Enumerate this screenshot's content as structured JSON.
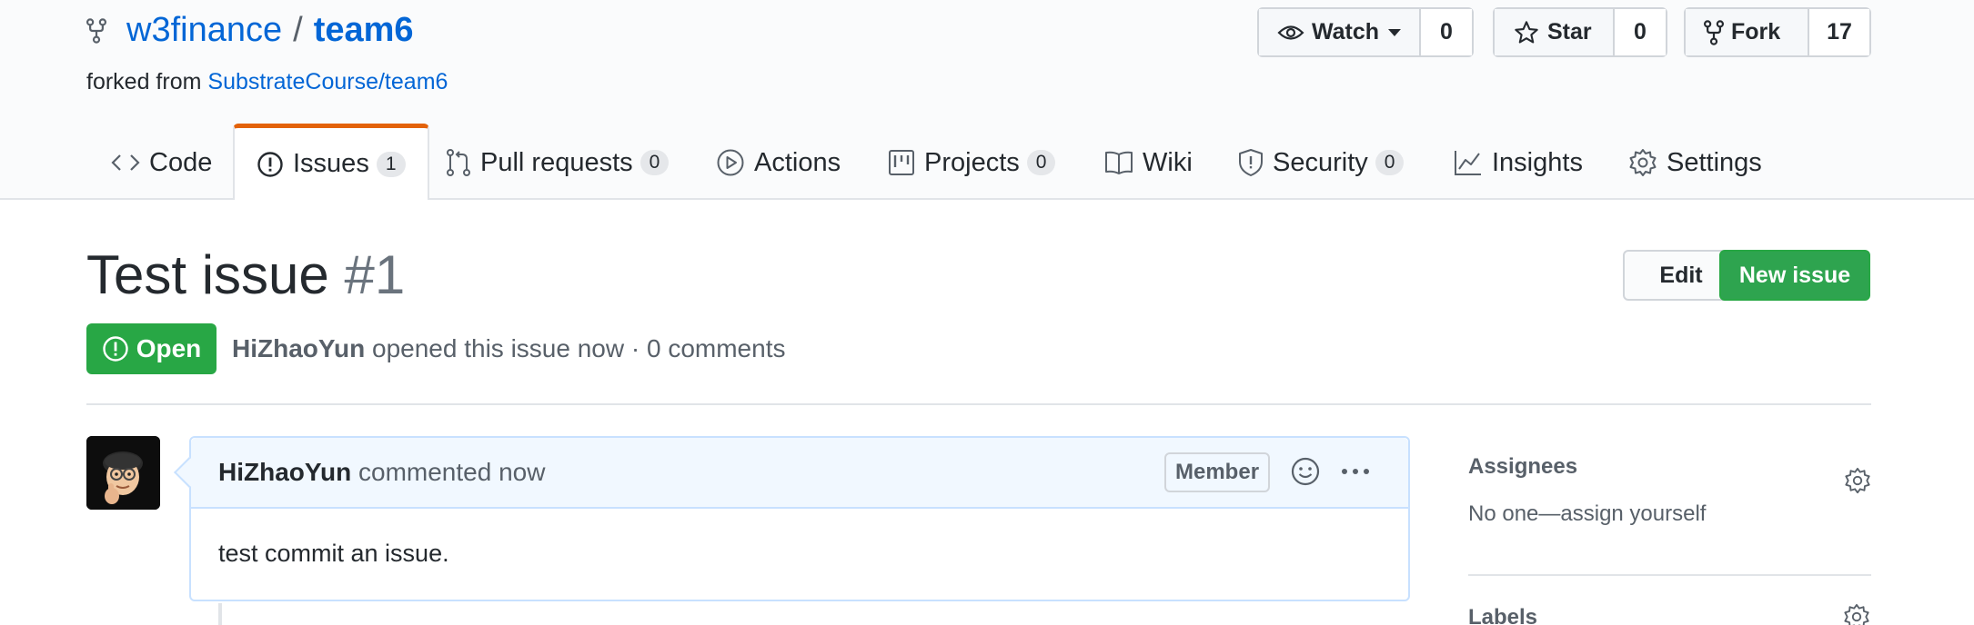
{
  "repo": {
    "owner": "w3finance",
    "separator": "/",
    "name": "team6",
    "forked_prefix": "forked from",
    "forked_from": "SubstrateCourse/team6"
  },
  "actions": {
    "watch_label": "Watch",
    "watch_count": "0",
    "star_label": "Star",
    "star_count": "0",
    "fork_label": "Fork",
    "fork_count": "17"
  },
  "tabs": [
    {
      "label": "Code",
      "icon": "code-icon"
    },
    {
      "label": "Issues",
      "count": "1",
      "icon": "issue-opened-icon",
      "selected": true
    },
    {
      "label": "Pull requests",
      "count": "0",
      "icon": "git-pull-request-icon"
    },
    {
      "label": "Actions",
      "icon": "play-icon"
    },
    {
      "label": "Projects",
      "count": "0",
      "icon": "project-icon"
    },
    {
      "label": "Wiki",
      "icon": "book-icon"
    },
    {
      "label": "Security",
      "count": "0",
      "icon": "shield-icon"
    },
    {
      "label": "Insights",
      "icon": "graph-icon"
    },
    {
      "label": "Settings",
      "icon": "gear-icon"
    }
  ],
  "issue": {
    "title": "Test issue",
    "number": "#1",
    "edit_label": "Edit",
    "new_issue_label": "New issue",
    "state": "Open",
    "author": "HiZhaoYun",
    "meta_text": "opened this issue now · 0 comments"
  },
  "comment": {
    "author": "HiZhaoYun",
    "action_text": "commented now",
    "badge": "Member",
    "body": "test commit an issue."
  },
  "sidebar": {
    "assignees_heading": "Assignees",
    "assignees_text": "No one—assign yourself",
    "labels_heading": "Labels"
  },
  "colors": {
    "link": "#0366d6",
    "open_green": "#28a745",
    "tab_accent": "#e36209",
    "comment_header_bg": "#f1f8ff"
  }
}
